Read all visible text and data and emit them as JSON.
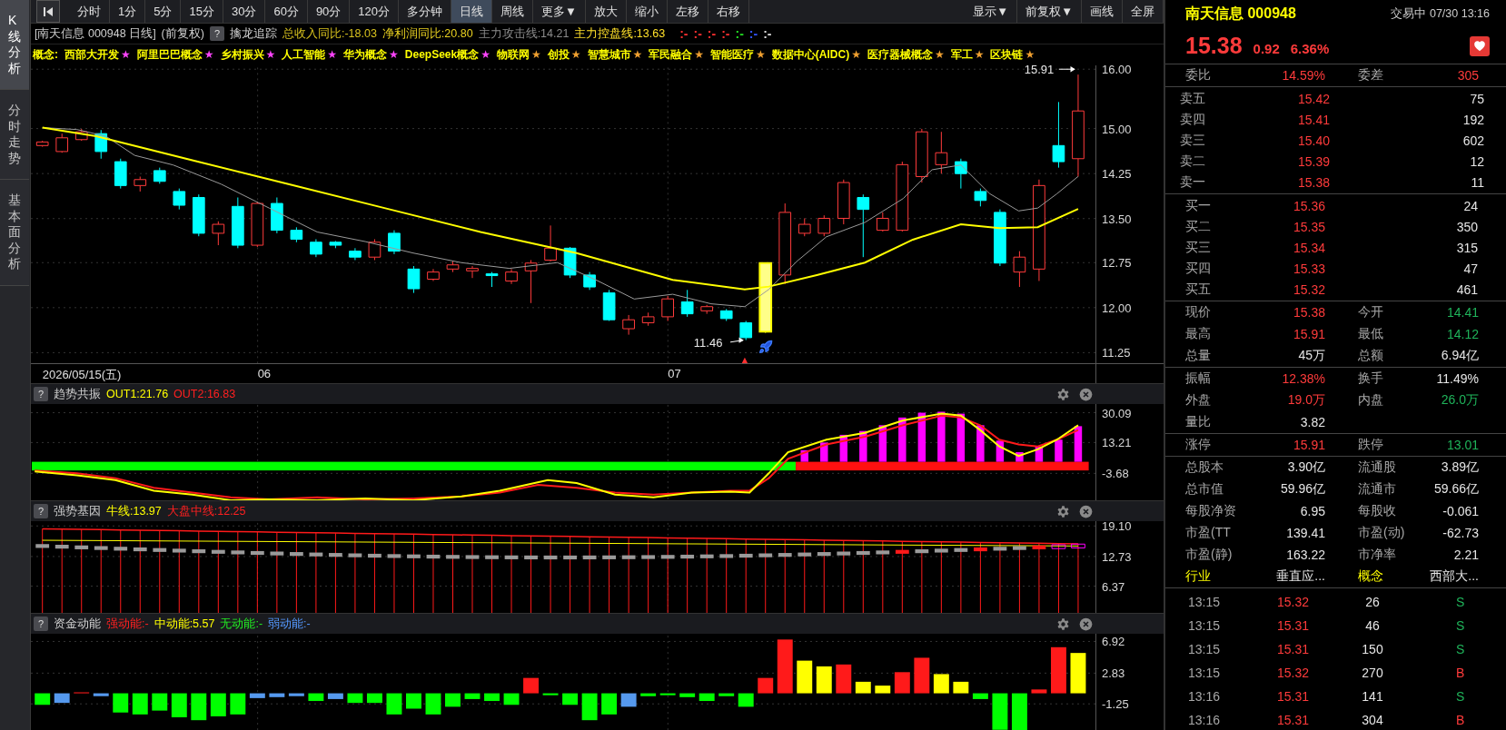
{
  "sidebar": {
    "tabs": [
      {
        "label": "K线分析",
        "selected": true
      },
      {
        "label": "分时走势",
        "selected": false
      },
      {
        "label": "基本面分析",
        "selected": false
      }
    ]
  },
  "toolbar": {
    "periods": [
      {
        "label": "分时",
        "selected": false
      },
      {
        "label": "1分",
        "selected": false
      },
      {
        "label": "5分",
        "selected": false
      },
      {
        "label": "15分",
        "selected": false
      },
      {
        "label": "30分",
        "selected": false
      },
      {
        "label": "60分",
        "selected": false
      },
      {
        "label": "90分",
        "selected": false
      },
      {
        "label": "120分",
        "selected": false
      },
      {
        "label": "多分钟",
        "selected": false
      },
      {
        "label": "日线",
        "selected": true
      },
      {
        "label": "周线",
        "selected": false
      },
      {
        "label": "更多▼",
        "selected": false
      }
    ],
    "tools": [
      "放大",
      "缩小",
      "左移",
      "右移"
    ],
    "actions": [
      "显示▼",
      "前复权▼",
      "画线",
      "全屏"
    ]
  },
  "info_line": {
    "title": "[南天信息 000948 日线]",
    "adjust": "(前复权)",
    "help": "?",
    "indicator": "擒龙追踪",
    "values": [
      {
        "text": "总收入同比:-18.03",
        "color": "#d8c21e"
      },
      {
        "text": "净利润同比:20.80",
        "color": "#e8d020"
      },
      {
        "text": "主力攻击线:14.21",
        "color": "#8c8c8c"
      },
      {
        "text": "主力控盘线:13.63",
        "color": "#ffe02a"
      }
    ],
    "markers": [
      {
        "text": ":-",
        "color": "#ff3030"
      },
      {
        "text": ":-",
        "color": "#ff3030"
      },
      {
        "text": ":-",
        "color": "#ff3030"
      },
      {
        "text": ":-",
        "color": "#ff3030"
      },
      {
        "text": ":-",
        "color": "#22dd22"
      },
      {
        "text": ":-",
        "color": "#3355ff"
      },
      {
        "text": ":-",
        "color": "#dddddd"
      }
    ]
  },
  "concepts": {
    "label": "概念:",
    "items": [
      {
        "name": "西部大开发",
        "mark": "★",
        "color": "#ff44ff"
      },
      {
        "name": "阿里巴巴概念",
        "mark": "★",
        "color": "#ff44ff"
      },
      {
        "name": "乡村振兴",
        "mark": "★",
        "color": "#ff44ff"
      },
      {
        "name": "人工智能",
        "mark": "★",
        "color": "#ff44ff"
      },
      {
        "name": "华为概念",
        "mark": "★",
        "color": "#ff44ff"
      },
      {
        "name": "DeepSeek概念",
        "mark": "★",
        "color": "#ff44ff"
      },
      {
        "name": "物联网",
        "mark": "★",
        "color": "#f0a030"
      },
      {
        "name": "创投",
        "mark": "★",
        "color": "#f0a030"
      },
      {
        "name": "智慧城市",
        "mark": "★",
        "color": "#f0a030"
      },
      {
        "name": "军民融合",
        "mark": "★",
        "color": "#f0a030"
      },
      {
        "name": "智能医疗",
        "mark": "★",
        "color": "#f0a030"
      },
      {
        "name": "数据中心(AIDC)",
        "mark": "★",
        "color": "#f0a030"
      },
      {
        "name": "医疗器械概念",
        "mark": "★",
        "color": "#f0a030"
      },
      {
        "name": "军工",
        "mark": "★",
        "color": "#f0a030"
      },
      {
        "name": "区块链",
        "mark": "★",
        "color": "#f0a030"
      }
    ]
  },
  "main_chart": {
    "price_ticks": [
      "16.00",
      "15.00",
      "14.25",
      "13.50",
      "12.75",
      "12.00",
      "11.25"
    ],
    "high_label": "15.91",
    "low_label": "11.46",
    "date_labels": [
      "2026/05/15(五)",
      "06",
      "07"
    ]
  },
  "panes": [
    {
      "help": "?",
      "title": "趋势共振",
      "values": [
        {
          "text": "OUT1:21.76",
          "color": "#ffff00"
        },
        {
          "text": "OUT2:16.83",
          "color": "#ff2020"
        }
      ],
      "ticks": [
        "30.09",
        "13.21",
        "-3.68"
      ]
    },
    {
      "help": "?",
      "title": "强势基因",
      "values": [
        {
          "text": "牛线:13.97",
          "color": "#ffff00"
        },
        {
          "text": "大盘中线:12.25",
          "color": "#ff2020"
        }
      ],
      "ticks": [
        "19.10",
        "12.73",
        "6.37"
      ]
    },
    {
      "help": "?",
      "title": "资金动能",
      "values": [
        {
          "text": "强动能:-",
          "color": "#ff2020"
        },
        {
          "text": "中动能:5.57",
          "color": "#ffff00"
        },
        {
          "text": "无动能:-",
          "color": "#22ee22"
        },
        {
          "text": "弱动能:-",
          "color": "#5599ff"
        }
      ],
      "ticks": [
        "6.92",
        "2.83",
        "-1.25"
      ]
    }
  ],
  "quote": {
    "name": "南天信息 000948",
    "status": "交易中 07/30 13:16",
    "price": "15.38",
    "change": "0.92",
    "change_pct": "6.36%",
    "ratio_row": [
      {
        "label": "委比",
        "value": "14.59%",
        "color": "#ff3b3b"
      },
      {
        "label": "委差",
        "value": "305",
        "color": "#ff3b3b"
      }
    ],
    "asks": [
      {
        "label": "卖五",
        "price": "15.42",
        "volume": "75"
      },
      {
        "label": "卖四",
        "price": "15.41",
        "volume": "192"
      },
      {
        "label": "卖三",
        "price": "15.40",
        "volume": "602"
      },
      {
        "label": "卖二",
        "price": "15.39",
        "volume": "12"
      },
      {
        "label": "卖一",
        "price": "15.38",
        "volume": "11"
      }
    ],
    "bids": [
      {
        "label": "买一",
        "price": "15.36",
        "volume": "24"
      },
      {
        "label": "买二",
        "price": "15.35",
        "volume": "350"
      },
      {
        "label": "买三",
        "price": "15.34",
        "volume": "315"
      },
      {
        "label": "买四",
        "price": "15.33",
        "volume": "47"
      },
      {
        "label": "买五",
        "price": "15.32",
        "volume": "461"
      }
    ],
    "stat_groups": [
      [
        [
          {
            "label": "现价",
            "value": "15.38",
            "color": "#ff3b3b"
          },
          {
            "label": "今开",
            "value": "14.41",
            "color": "#1fb35a"
          }
        ],
        [
          {
            "label": "最高",
            "value": "15.91",
            "color": "#ff3b3b"
          },
          {
            "label": "最低",
            "value": "14.12",
            "color": "#1fb35a"
          }
        ],
        [
          {
            "label": "总量",
            "value": "45万",
            "color": "#e6e6e6"
          },
          {
            "label": "总额",
            "value": "6.94亿",
            "color": "#e6e6e6"
          }
        ]
      ],
      [
        [
          {
            "label": "振幅",
            "value": "12.38%",
            "color": "#ff3b3b"
          },
          {
            "label": "换手",
            "value": "11.49%",
            "color": "#e6e6e6"
          }
        ],
        [
          {
            "label": "外盘",
            "value": "19.0万",
            "color": "#ff3b3b"
          },
          {
            "label": "内盘",
            "value": "26.0万",
            "color": "#1fb35a"
          }
        ],
        [
          {
            "label": "量比",
            "value": "3.82",
            "color": "#e6e6e6"
          }
        ]
      ],
      [
        [
          {
            "label": "涨停",
            "value": "15.91",
            "color": "#ff3b3b"
          },
          {
            "label": "跌停",
            "value": "13.01",
            "color": "#1fb35a"
          }
        ]
      ],
      [
        [
          {
            "label": "总股本",
            "value": "3.90亿",
            "color": "#e6e6e6"
          },
          {
            "label": "流通股",
            "value": "3.89亿",
            "color": "#e6e6e6"
          }
        ],
        [
          {
            "label": "总市值",
            "value": "59.96亿",
            "color": "#e6e6e6"
          },
          {
            "label": "流通市",
            "value": "59.66亿",
            "color": "#e6e6e6"
          }
        ],
        [
          {
            "label": "每股净资",
            "value": "6.95",
            "color": "#e6e6e6"
          },
          {
            "label": "每股收",
            "value": "-0.061",
            "color": "#e6e6e6"
          }
        ],
        [
          {
            "label": "市盈(TT",
            "value": "139.41",
            "color": "#e6e6e6"
          },
          {
            "label": "市盈(动)",
            "value": "-62.73",
            "color": "#e6e6e6"
          }
        ],
        [
          {
            "label": "市盈(静)",
            "value": "163.22",
            "color": "#e6e6e6"
          },
          {
            "label": "市净率",
            "value": "2.21",
            "color": "#e6e6e6"
          }
        ]
      ]
    ],
    "industry_row": [
      {
        "label": "行业",
        "value": "垂直应..."
      },
      {
        "label": "概念",
        "value": "西部大..."
      }
    ],
    "trades": [
      {
        "time": "13:15",
        "price": "15.32",
        "volume": "26",
        "side": "S",
        "kind": "sell"
      },
      {
        "time": "13:15",
        "price": "15.31",
        "volume": "46",
        "side": "S",
        "kind": "sell"
      },
      {
        "time": "13:15",
        "price": "15.31",
        "volume": "150",
        "side": "S",
        "kind": "sell"
      },
      {
        "time": "13:15",
        "price": "15.32",
        "volume": "270",
        "side": "B",
        "kind": "buy"
      },
      {
        "time": "13:16",
        "price": "15.31",
        "volume": "141",
        "side": "S",
        "kind": "sell"
      },
      {
        "time": "13:16",
        "price": "15.31",
        "volume": "304",
        "side": "B",
        "kind": "buy"
      }
    ]
  }
}
